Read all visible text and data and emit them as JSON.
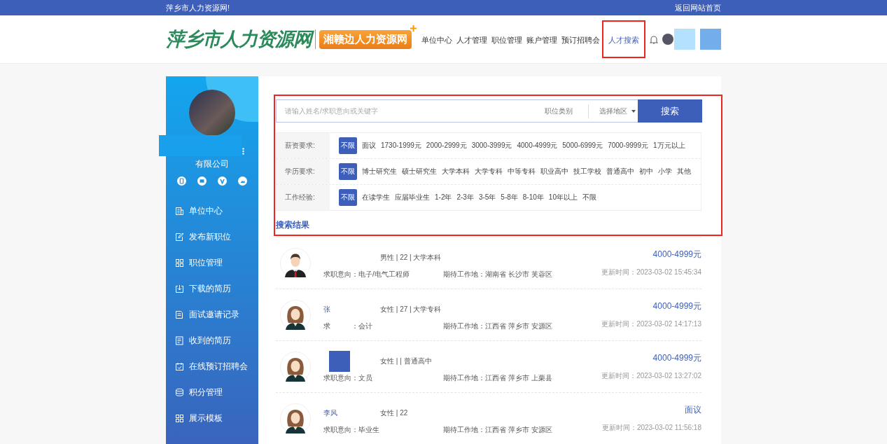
{
  "top_bar": {
    "site_name": "萍乡市人力资源网!",
    "home_link": "返回网站首页"
  },
  "header": {
    "logo": "萍乡市人力资源网",
    "badge": "湘赣边人力资源网",
    "nav": [
      {
        "label": "单位中心",
        "selected": false
      },
      {
        "label": "人才管理",
        "selected": false
      },
      {
        "label": "职位管理",
        "selected": false
      },
      {
        "label": "账户管理",
        "selected": false
      },
      {
        "label": "预订招聘会",
        "selected": false
      },
      {
        "label": "人才搜索",
        "selected": true
      }
    ]
  },
  "sidebar": {
    "company": "有限公司",
    "items": [
      {
        "label": "单位中心",
        "kind": "building"
      },
      {
        "label": "发布新职位",
        "kind": "edit"
      },
      {
        "label": "职位管理",
        "kind": "grid"
      },
      {
        "label": "下载的简历",
        "kind": "download"
      },
      {
        "label": "面试邀请记录",
        "kind": "note"
      },
      {
        "label": "收到的简历",
        "kind": "doc"
      },
      {
        "label": "在线预订招聘会",
        "kind": "calendar"
      },
      {
        "label": "积分管理",
        "kind": "coins"
      },
      {
        "label": "展示模板",
        "kind": "grid"
      }
    ]
  },
  "search": {
    "placeholder": "请输入姓名/求职意向或关键字",
    "category": "职位类别",
    "region": "选择地区",
    "button": "搜索"
  },
  "filters": [
    {
      "label": "薪资要求:",
      "options": [
        {
          "label": "不限",
          "selected": true
        },
        {
          "label": "面议",
          "selected": false
        },
        {
          "label": "1730-1999元",
          "selected": false
        },
        {
          "label": "2000-2999元",
          "selected": false
        },
        {
          "label": "3000-3999元",
          "selected": false
        },
        {
          "label": "4000-4999元",
          "selected": false
        },
        {
          "label": "5000-6999元",
          "selected": false
        },
        {
          "label": "7000-9999元",
          "selected": false
        },
        {
          "label": "1万元以上",
          "selected": false
        }
      ]
    },
    {
      "label": "学历要求:",
      "options": [
        {
          "label": "不限",
          "selected": true
        },
        {
          "label": "博士研究生",
          "selected": false
        },
        {
          "label": "硕士研究生",
          "selected": false
        },
        {
          "label": "大学本科",
          "selected": false
        },
        {
          "label": "大学专科",
          "selected": false
        },
        {
          "label": "中等专科",
          "selected": false
        },
        {
          "label": "职业高中",
          "selected": false
        },
        {
          "label": "技工学校",
          "selected": false
        },
        {
          "label": "普通高中",
          "selected": false
        },
        {
          "label": "初中",
          "selected": false
        },
        {
          "label": "小学",
          "selected": false
        },
        {
          "label": "其他",
          "selected": false
        }
      ]
    },
    {
      "label": "工作经验:",
      "options": [
        {
          "label": "不限",
          "selected": true
        },
        {
          "label": "在读学生",
          "selected": false
        },
        {
          "label": "应届毕业生",
          "selected": false
        },
        {
          "label": "1-2年",
          "selected": false
        },
        {
          "label": "2-3年",
          "selected": false
        },
        {
          "label": "3-5年",
          "selected": false
        },
        {
          "label": "5-8年",
          "selected": false
        },
        {
          "label": "8-10年",
          "selected": false
        },
        {
          "label": "10年以上",
          "selected": false
        },
        {
          "label": "不限",
          "selected": false
        }
      ]
    }
  ],
  "results_title": "搜索结果",
  "results": [
    {
      "kind": "male",
      "name_redacted": false,
      "info": "男性 | 22 | 大学本科",
      "salary": "4000-4999元",
      "intent": "求职意向：电子/电气工程师",
      "location": "期待工作地：湖南省 长沙市 芙蓉区",
      "updated": "更新时间：2023-03-02 15:45:34"
    },
    {
      "kind": "female",
      "name": "张",
      "name_redacted": false,
      "info": "女性 | 27 | 大学专科",
      "salary": "4000-4999元",
      "intent": "求　　　：会计",
      "location": "期待工作地：江西省 萍乡市 安源区",
      "updated": "更新时间：2023-03-02 14:17:13"
    },
    {
      "kind": "female",
      "name_redacted": true,
      "info": "女性 | | 普通高中",
      "salary": "4000-4999元",
      "intent": "求职意向：文员",
      "location": "期待工作地：江西省 萍乡市 上栗县",
      "updated": "更新时间：2023-03-02 13:27:02"
    },
    {
      "kind": "female",
      "name": "李风",
      "name_redacted": false,
      "info": "女性 | 22",
      "salary": "面议",
      "intent": "求职意向：毕业生",
      "location": "期待工作地：江西省 萍乡市 安源区",
      "updated": "更新时间：2023-03-02 11:56:18"
    }
  ]
}
